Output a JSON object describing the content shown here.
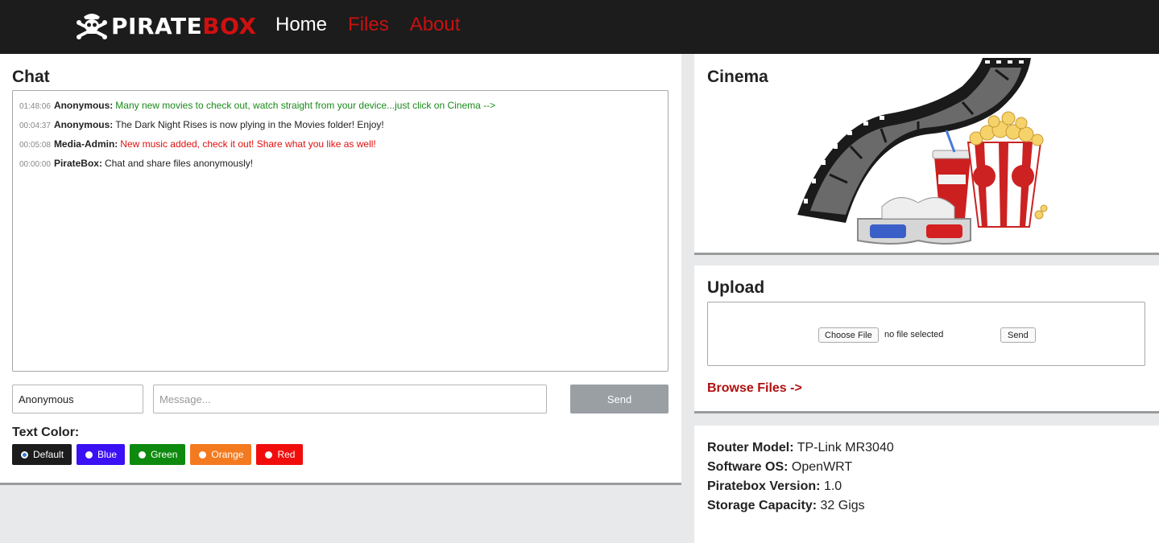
{
  "header": {
    "logo_text_white": "PIRATE",
    "logo_text_red": "BOX",
    "nav": [
      {
        "label": "Home",
        "color": "#ffffff"
      },
      {
        "label": "Files",
        "color": "#c81010"
      },
      {
        "label": "About",
        "color": "#c81010"
      }
    ]
  },
  "chat": {
    "title": "Chat",
    "messages": [
      {
        "time": "01:48:06",
        "name": "Anonymous:",
        "text": "Many new movies to check out, watch straight from your device...just click on Cinema -->",
        "color": "#1a8a1a"
      },
      {
        "time": "00:04:37",
        "name": "Anonymous:",
        "text": "The Dark Night Rises is now plying in the Movies folder! Enjoy!",
        "color": "#222222"
      },
      {
        "time": "00:05:08",
        "name": "Media-Admin:",
        "text": "New music added, check it out! Share what you like as well!",
        "color": "#e01010"
      },
      {
        "time": "00:00:00",
        "name": "PirateBox:",
        "text": "Chat and share files anonymously!",
        "color": "#222222"
      }
    ],
    "name_value": "Anonymous",
    "message_placeholder": "Message...",
    "send_label": "Send",
    "text_color_label": "Text Color:",
    "colors": [
      {
        "label": "Default",
        "bg": "#1c1c1c",
        "selected": true
      },
      {
        "label": "Blue",
        "bg": "#3b10f5",
        "selected": false
      },
      {
        "label": "Green",
        "bg": "#0e8a0e",
        "selected": false
      },
      {
        "label": "Orange",
        "bg": "#f47a20",
        "selected": false
      },
      {
        "label": "Red",
        "bg": "#f20d0d",
        "selected": false
      }
    ]
  },
  "cinema": {
    "title": "Cinema",
    "image_icon": "film-popcorn-3d-glasses-icon"
  },
  "upload": {
    "title": "Upload",
    "choose_label": "Choose File",
    "no_file_text": "no file selected",
    "send_label": "Send",
    "browse_label": "Browse Files ->"
  },
  "info": [
    {
      "key": "Router Model:",
      "value": "TP-Link MR3040"
    },
    {
      "key": "Software OS:",
      "value": "OpenWRT"
    },
    {
      "key": "Piratebox Version:",
      "value": "1.0"
    },
    {
      "key": "Storage Capacity:",
      "value": "32 Gigs"
    }
  ]
}
